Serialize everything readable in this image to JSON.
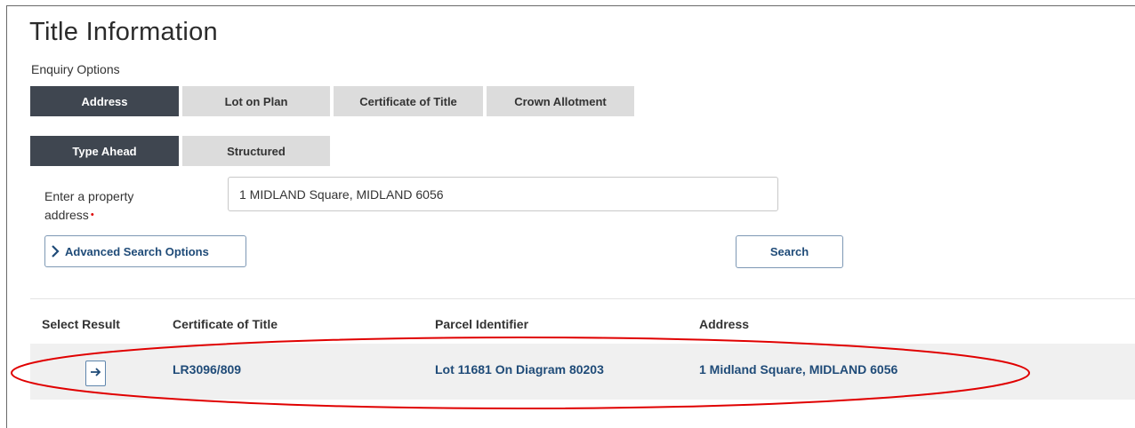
{
  "page": {
    "title": "Title Information",
    "enquiry_label": "Enquiry Options"
  },
  "enquiry_tabs": [
    {
      "label": "Address",
      "active": true
    },
    {
      "label": "Lot on Plan",
      "active": false
    },
    {
      "label": "Certificate of Title",
      "active": false
    },
    {
      "label": "Crown Allotment",
      "active": false
    }
  ],
  "search_mode_tabs": [
    {
      "label": "Type Ahead",
      "active": true
    },
    {
      "label": "Structured",
      "active": false
    }
  ],
  "address_field": {
    "label_line1": "Enter a property",
    "label_line2": "address",
    "required_marker": "•",
    "value": "1 MIDLAND Square, MIDLAND 6056"
  },
  "buttons": {
    "advanced_label": "Advanced Search Options",
    "search_label": "Search"
  },
  "results": {
    "columns": [
      "Select Result",
      "Certificate of Title",
      "Parcel Identifier",
      "Address"
    ],
    "rows": [
      {
        "certificate": "LR3096/809",
        "parcel": "Lot 11681 On Diagram 80203",
        "address": "1 Midland Square, MIDLAND 6056"
      }
    ]
  },
  "colors": {
    "active_tab": "#3f4650",
    "inactive_tab": "#dcdcdc",
    "link": "#1f4b78",
    "highlight_annotation": "#e00000"
  },
  "icons": {
    "advanced": "chevron-right-icon",
    "select": "arrow-right-icon"
  }
}
